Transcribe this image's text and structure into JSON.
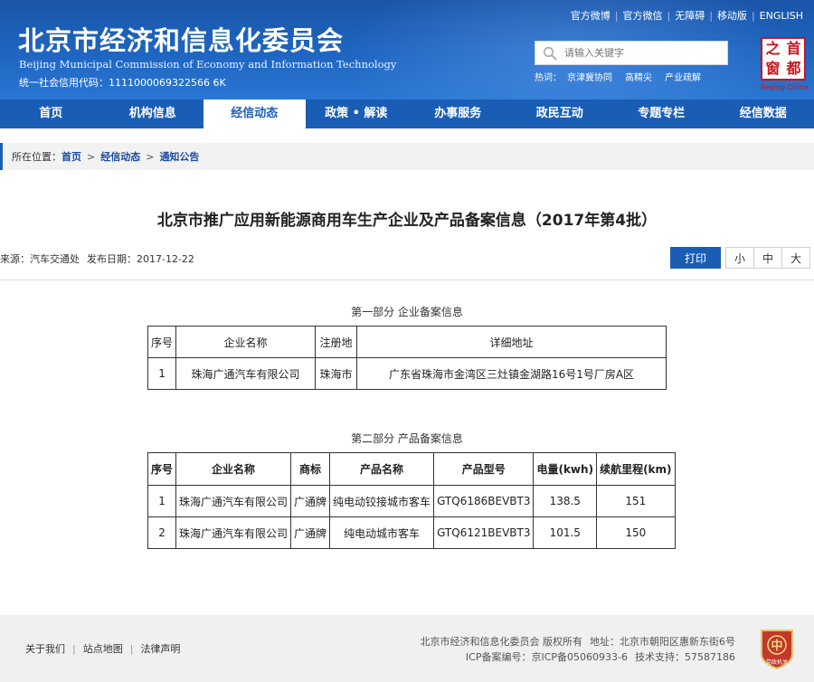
{
  "header": {
    "title": "北京市经济和信息化委员会",
    "subtitle": "Beijing Municipal Commission of Economy and Information Technology",
    "credit_code": "统一社会信用代码：1111000069322566 6K",
    "top_links": [
      "官方微博",
      "官方微信",
      "无障碍",
      "移动版",
      "ENGLISH"
    ],
    "search_placeholder": "请输入关键字",
    "hot_label": "热词：",
    "hot_words": [
      "京津冀协同",
      "高精尖",
      "产业疏解"
    ],
    "logo_chars": [
      "首",
      "之",
      "都",
      "窗"
    ],
    "logo_caption": "Beijing China"
  },
  "nav": {
    "items": [
      "首页",
      "机构信息",
      "经信动态",
      "政策 • 解读",
      "办事服务",
      "政民互动",
      "专题专栏",
      "经信数据"
    ],
    "active_index": 2
  },
  "breadcrumb": {
    "label": "所在位置：",
    "items": [
      "首页",
      "经信动态",
      "通知公告"
    ]
  },
  "article": {
    "title": "北京市推广应用新能源商用车生产企业及产品备案信息（2017年第4批）",
    "source": "来源：汽车交通处",
    "date": "发布日期：2017-12-22",
    "print_label": "打印",
    "font_sizes": [
      "小",
      "中",
      "大"
    ]
  },
  "part1": {
    "title": "第一部分  企业备案信息",
    "headers": [
      "序号",
      "企业名称",
      "注册地",
      "详细地址"
    ],
    "rows": [
      [
        "1",
        "珠海广通汽车有限公司",
        "珠海市",
        "广东省珠海市金湾区三灶镇金湖路16号1号厂房A区"
      ]
    ]
  },
  "part2": {
    "title": "第二部分  产品备案信息",
    "headers": [
      "序号",
      "企业名称",
      "商标",
      "产品名称",
      "产品型号",
      "电量(kwh)",
      "续航里程(km)"
    ],
    "rows": [
      [
        "1",
        "珠海广通汽车有限公司",
        "广通牌",
        "纯电动铰接城市客车",
        "GTQ6186BEVBT3",
        "138.5",
        "151"
      ],
      [
        "2",
        "珠海广通汽车有限公司",
        "广通牌",
        "纯电动城市客车",
        "GTQ6121BEVBT3",
        "101.5",
        "150"
      ]
    ]
  },
  "footer": {
    "links": [
      "关于我们",
      "站点地图",
      "法律声明"
    ],
    "copyright": "北京市经济和信息化委员会 版权所有",
    "address": "地址：北京市朝阳区惠新东街6号",
    "icp": "ICP备案编号：京ICP备05060933-6",
    "support": "技术支持：57587186",
    "badge_text": "党政机关"
  },
  "colors": {
    "brand_blue": "#1a5db5",
    "stamp_red": "#c8161d"
  }
}
